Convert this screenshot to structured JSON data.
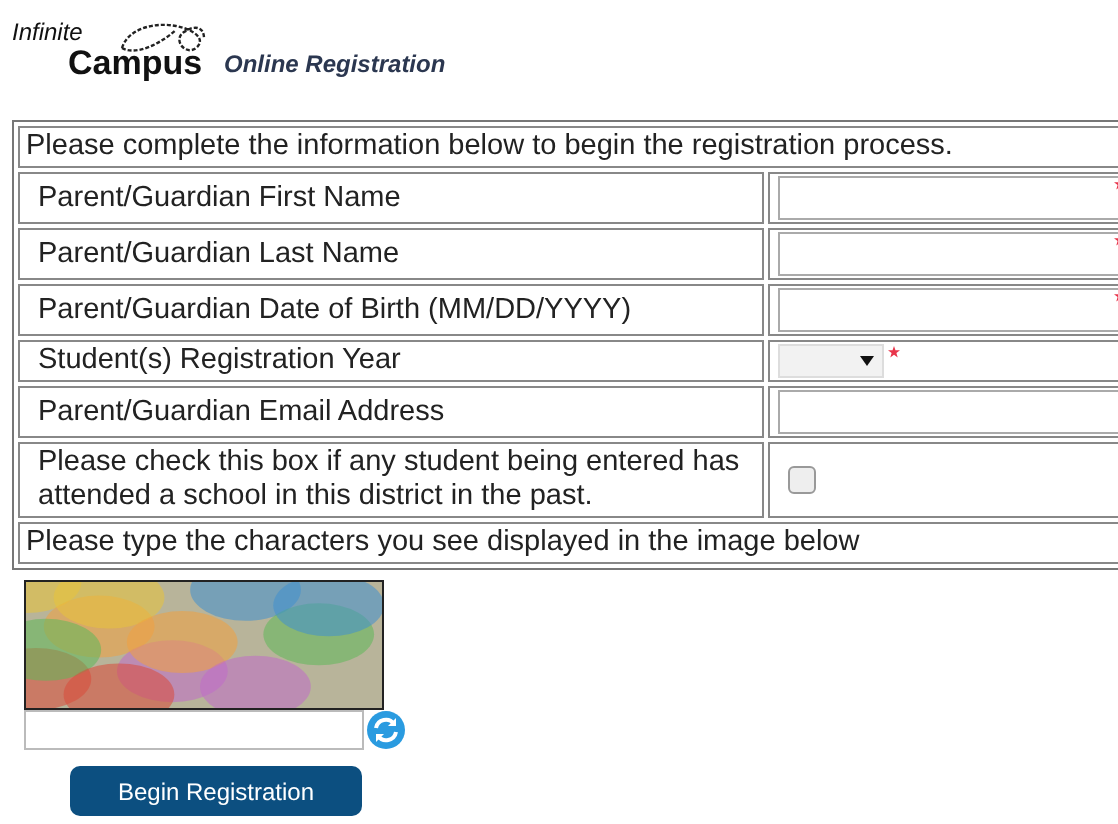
{
  "header": {
    "logo_top": "Infinite",
    "logo_bottom": "Campus",
    "title": "Online Registration"
  },
  "form": {
    "intro": "Please complete the information below to begin the registration process.",
    "fields": [
      {
        "label": "Parent/Guardian First Name",
        "kind": "text",
        "required": true
      },
      {
        "label": "Parent/Guardian Last Name",
        "kind": "text",
        "required": true
      },
      {
        "label": "Parent/Guardian Date of Birth (MM/DD/YYYY)",
        "kind": "text",
        "required": true
      },
      {
        "label": "Student(s) Registration Year",
        "kind": "select",
        "required": true
      },
      {
        "label": "Parent/Guardian Email Address",
        "kind": "text",
        "required": false
      },
      {
        "label": "Please check this box if any student being entered has attended a school in this district in the past.",
        "kind": "checkbox",
        "required": false,
        "checked": false
      }
    ],
    "captcha_instruction": "Please type the characters you see displayed in the image below"
  },
  "submit_button": "Begin Registration"
}
